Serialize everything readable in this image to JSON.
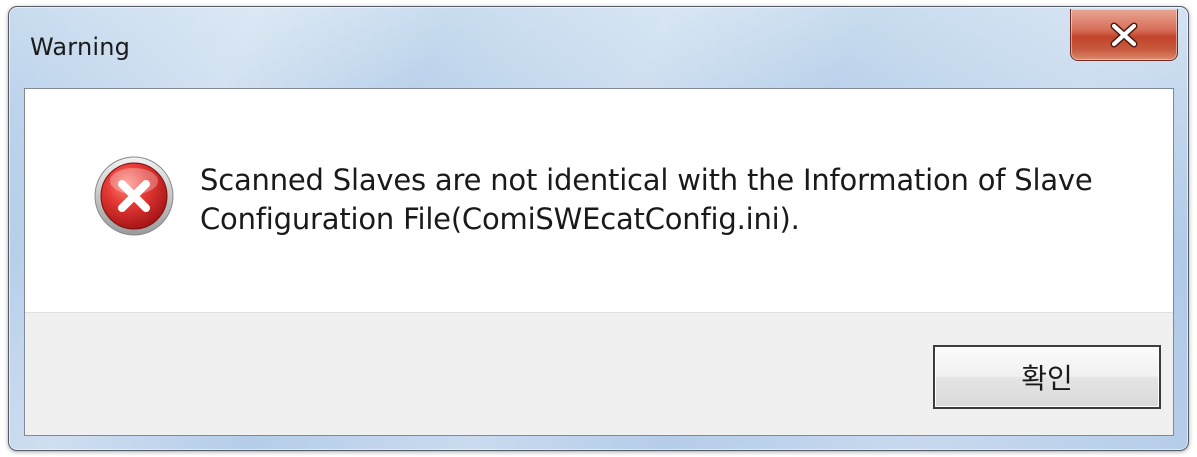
{
  "dialog": {
    "title": "Warning",
    "close_icon": "close-x-icon",
    "message_icon": "error-icon",
    "message_line1": "Scanned Slaves are not identical with the Information of Slave",
    "message_line2": "Configuration File(ComiSWEcatConfig.ini).",
    "ok_label": "확인"
  },
  "colors": {
    "close_button": "#c7432a",
    "error_icon": "#d32f2f",
    "button_area_bg": "#f0f0f0",
    "title_bar": "#b9d0ea"
  }
}
